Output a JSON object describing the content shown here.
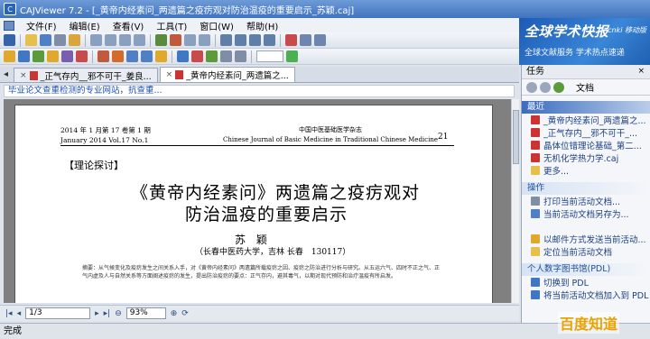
{
  "window": {
    "title": "CAJViewer 7.2 - [_黄帝内经素问_两遗篇之疫疠观对防治温疫的重要启示_苏颖.caj]"
  },
  "menu": {
    "items": [
      "文件(F)",
      "编辑(E)",
      "查看(V)",
      "工具(T)",
      "窗口(W)",
      "帮助(H)"
    ]
  },
  "banner": {
    "title": "全球学术快报",
    "tag": "cnki 移动版",
    "subtitle": "全球文献服务 学术热点速递"
  },
  "tabs": [
    {
      "label": "_正气存内__邪不可干_姜良..."
    },
    {
      "label": "_黄帝内经素问_两遗篇之..."
    }
  ],
  "linkbar": {
    "text": "毕业论文查重检测的专业网站，抗查重..."
  },
  "document": {
    "header_left_1": "2014 年 1 月第 17 卷第 1 期",
    "header_left_2": "January 2014 Vol.17 No.1",
    "header_center_1": "中国中医基础医学杂志",
    "header_center_2": "Chinese Journal of Basic Medicine in Traditional Chinese Medicine",
    "page_number": "21",
    "column_tag": "【理论探讨】",
    "title_line1": "《黄帝内经素问》两遗篇之疫疠观对",
    "title_line2": "防治温疫的重要启示",
    "author": "苏  颖",
    "affiliation": "（长春中医药大学，吉林 长春　130117）",
    "abstract": "摘要：从气候变化及疫疠发生之间关系入手，对《黄帝内经素问》两遗篇所载疫疠之因、疫疠之防治进行分析与研究。从五运六气、四时不正之气、正气内虚及人与自然关系等方面阐述疫疠的发生，提出防治疫疠的要点：正气存内，避其毒气，以期对现代预防和治疗温疫有所启发。"
  },
  "navigation": {
    "page": "1/3",
    "zoom": "93%"
  },
  "status": {
    "text": "完成"
  },
  "taskpane": {
    "title": "任务",
    "nav_label": "文档",
    "sections": [
      {
        "heading": "最近",
        "items": [
          "_黄帝内经素问_两遗篇之...",
          "_正气存内__邪不可干_...",
          "晶体位错理论基础_第二...",
          "无机化学热力学.caj",
          "更多..."
        ]
      },
      {
        "heading": "操作",
        "items": [
          "打印当前活动文档...",
          "当前活动文档另存为...",
          "",
          "以邮件方式发送当前活动...",
          "定位当前活动文档"
        ]
      },
      {
        "heading": "个人数字图书馆(PDL)",
        "items": [
          "切换到 PDL",
          "将当前活动文档加入到 PDL"
        ]
      }
    ]
  },
  "watermark": {
    "text": "百度知道"
  },
  "colors": {
    "titlebar": "#3f74c0",
    "link": "#1a4fb5",
    "banner": "#1d5bb5",
    "watermark": "#e8a300"
  }
}
